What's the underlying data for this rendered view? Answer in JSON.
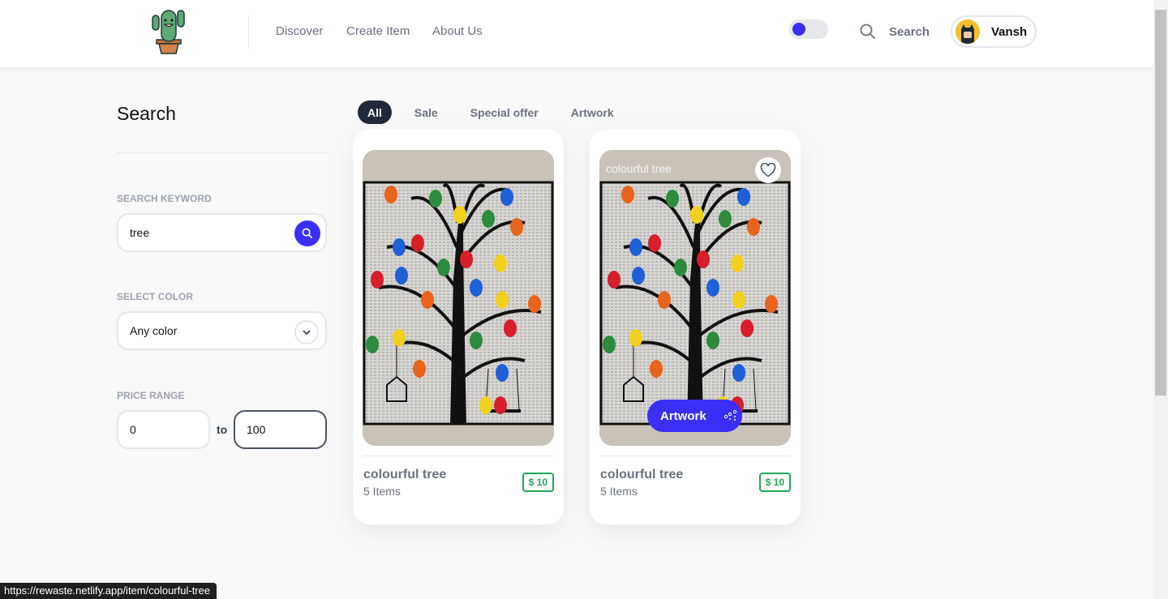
{
  "header": {
    "logo": "cactus-logo",
    "nav": [
      "Discover",
      "Create Item",
      "About Us"
    ],
    "theme_toggle": "dark-mode-toggle",
    "search_label": "Search",
    "user_name": "Vansh"
  },
  "sidebar": {
    "title": "Search",
    "keyword_label": "SEARCH KEYWORD",
    "keyword_value": "tree",
    "color_label": "SELECT COLOR",
    "color_value": "Any color",
    "price_label": "PRICE RANGE",
    "price_min": "0",
    "price_to": "to",
    "price_max": "100"
  },
  "tabs": [
    {
      "label": "All",
      "active": true
    },
    {
      "label": "Sale"
    },
    {
      "label": "Special offer"
    },
    {
      "label": "Artwork"
    }
  ],
  "cards": [
    {
      "name": "colourful tree",
      "count": "5 Items",
      "price": "$ 10"
    },
    {
      "name": "colourful tree",
      "count": "5 Items",
      "price": "$ 10",
      "overlay_title": "colourful tree",
      "category": "Artwork"
    }
  ],
  "status_url": "https://rewaste.netlify.app/item/colourful-tree",
  "colors": {
    "accent": "#3b2ff5",
    "price": "#22a55a",
    "dark": "#1f2937"
  }
}
